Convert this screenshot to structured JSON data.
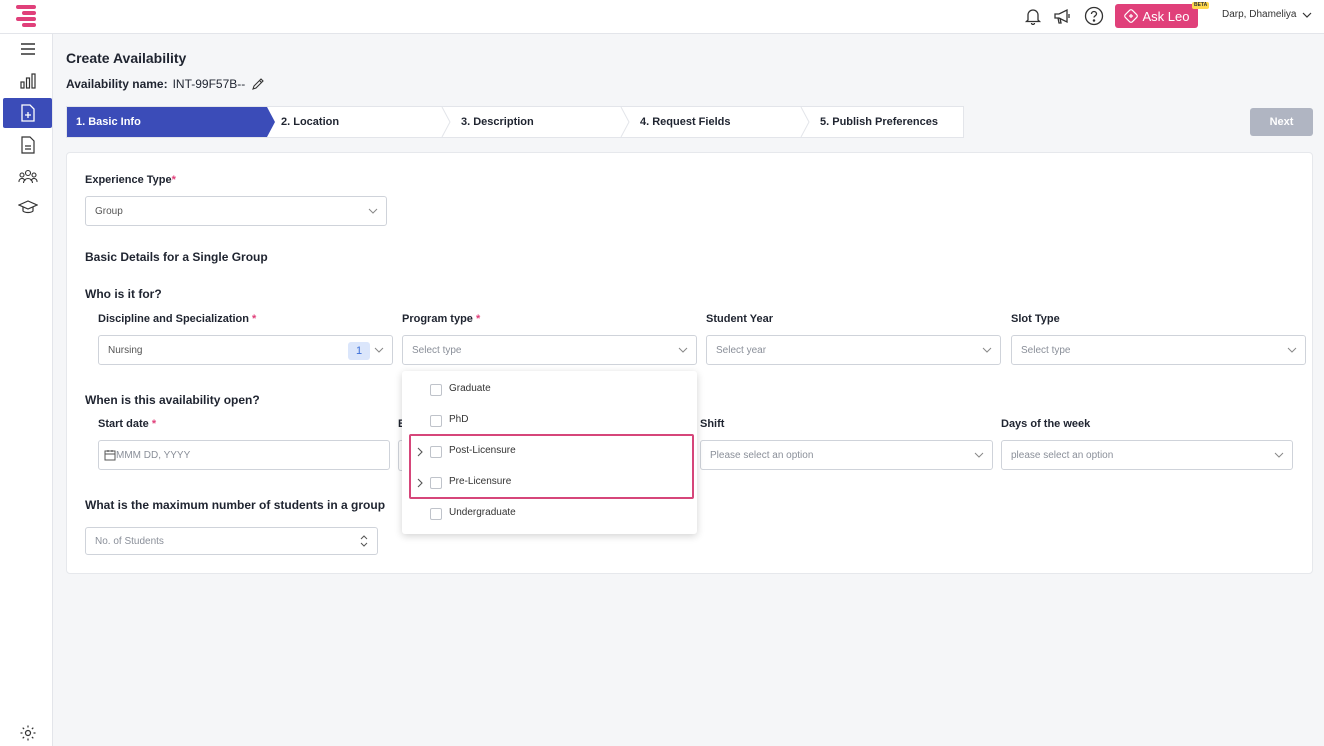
{
  "header": {
    "ask_leo_label": "Ask Leo",
    "beta_label": "BETA",
    "user_name": "Darp, Dhameliya",
    "icons": [
      "bell-icon",
      "megaphone-icon",
      "help-icon"
    ]
  },
  "sidebar": {
    "items": [
      {
        "icon": "menu-icon"
      },
      {
        "icon": "analytics-icon"
      },
      {
        "icon": "add-document-icon",
        "active": true
      },
      {
        "icon": "document-icon"
      },
      {
        "icon": "users-icon"
      },
      {
        "icon": "graduation-cap-icon"
      },
      {
        "icon": "settings-icon"
      }
    ]
  },
  "page": {
    "title": "Create Availability",
    "availability_label": "Availability name:",
    "availability_value": "INT-99F57B--"
  },
  "steps": [
    {
      "label": "1.  Basic Info",
      "active": true
    },
    {
      "label": "2.  Location"
    },
    {
      "label": "3.  Description"
    },
    {
      "label": "4.  Request Fields"
    },
    {
      "label": "5.  Publish Preferences"
    }
  ],
  "next_label": "Next",
  "form": {
    "experience_type_label": "Experience Type",
    "experience_type_value": "Group",
    "basic_details_heading": "Basic Details for a Single Group",
    "who_heading": "Who is it for?",
    "discipline_label": "Discipline and Specialization",
    "discipline_value": "Nursing",
    "discipline_count": "1",
    "program_type_label": "Program type",
    "program_type_placeholder": "Select type",
    "student_year_label": "Student Year",
    "student_year_placeholder": "Select year",
    "slot_type_label": "Slot Type",
    "slot_type_placeholder": "Select type",
    "when_heading": "When is this availability open?",
    "start_date_label": "Start date",
    "start_date_placeholder": "MMM DD, YYYY",
    "end_date_partial_label": "E",
    "shift_label": "Shift",
    "shift_placeholder": "Please select an option",
    "days_label": "Days of the week",
    "days_placeholder": "please select an option",
    "max_students_heading": "What is the maximum number of students in a group",
    "students_placeholder": "No. of Students",
    "required_mark": "*"
  },
  "program_type_options": [
    {
      "label": "Graduate",
      "expandable": false
    },
    {
      "label": "PhD",
      "expandable": false
    },
    {
      "label": "Post-Licensure",
      "expandable": true
    },
    {
      "label": "Pre-Licensure",
      "expandable": true
    },
    {
      "label": "Undergraduate",
      "expandable": false
    }
  ],
  "colors": {
    "brand_pink": "#e0407a",
    "active_blue": "#3b4cb8"
  }
}
